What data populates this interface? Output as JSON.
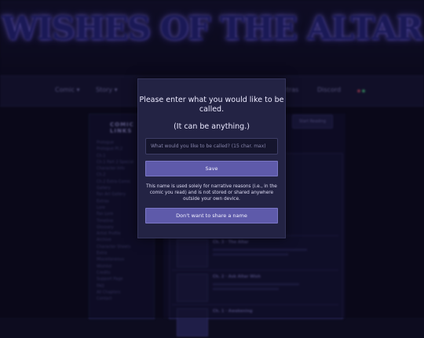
{
  "site": {
    "logo_text": "WISHES OF THE ALTAR",
    "nav": [
      {
        "label": "Comic ▾"
      },
      {
        "label": "Story ▾"
      },
      {
        "label": "Extras"
      },
      {
        "label": "Discord"
      }
    ],
    "sidebar_title": "COMIC LINKS",
    "sidebar_links": [
      "Prologue",
      "Prologue Pt.2",
      "Ch.1",
      "Ch.1 Part 2 Special",
      "Character Info",
      "Ch.2",
      "Ch.2 Extra Comic",
      "Gallery",
      "Fan Art Gallery",
      "Extras",
      "Lore",
      "Fan Lore",
      "Timeline",
      "Glossary",
      "Artist Profile",
      "Archive",
      "Character Sheets",
      "Extra",
      "Miscellaneous",
      "Wishlist",
      "Credits",
      "Support Page",
      "FAQ",
      "All Chapters",
      "Contact"
    ],
    "content_button": "Start Reading",
    "entries": [
      {
        "title": "Ch. 3 · The Altar"
      },
      {
        "title": "Ch. 2 · Ask Altar Wish"
      },
      {
        "title": "Ch. 1 · Awakening"
      }
    ]
  },
  "modal": {
    "heading": "Please enter what you would like to be called.",
    "subheading": "(It can be anything.)",
    "input_placeholder": "What would you like to be called? (15 char. max)",
    "input_value": "",
    "save_label": "Save",
    "disclaimer": "This name is used solely for narrative reasons (i.e., in the comic you read) and is not stored or shared anywhere outside your own device.",
    "decline_label": "Don't want to share a name"
  }
}
